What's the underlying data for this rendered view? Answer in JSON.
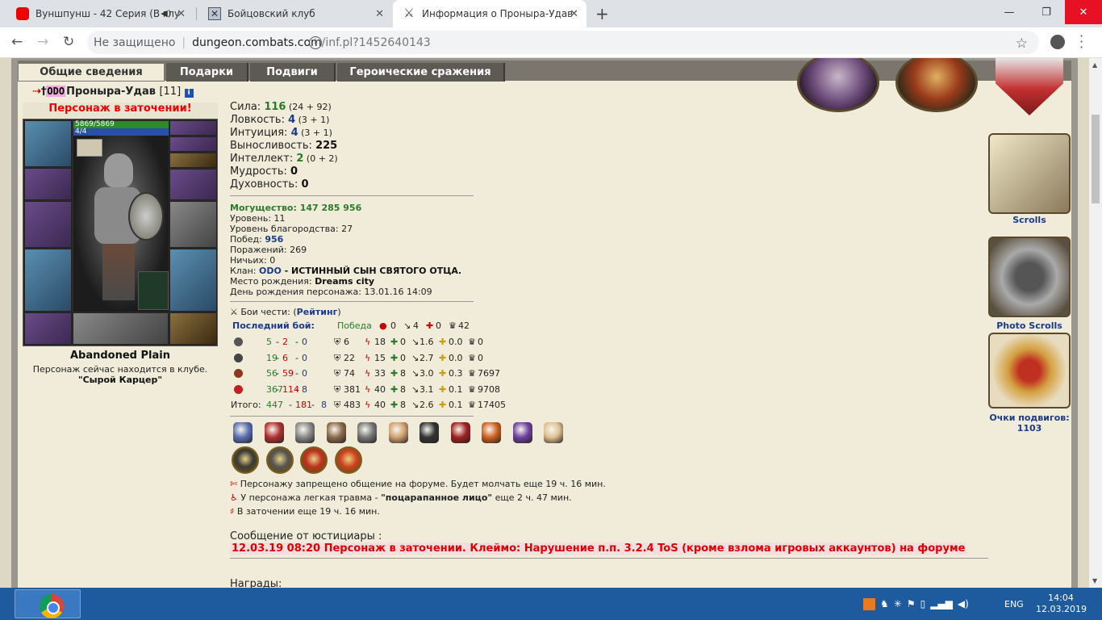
{
  "browser": {
    "tabs": [
      {
        "title": "Вуншпунш - 42 Серия (В глу"
      },
      {
        "title": "Бойцовский клуб"
      },
      {
        "title": "Информация о Проныра-Удав"
      }
    ],
    "new_tab": "+",
    "security": "Не защищено",
    "url_host": "dungeon.combats.com",
    "url_path": "/inf.pl?1452640143",
    "window_controls": {
      "minimize": "—",
      "restore": "❐",
      "close": "✕"
    }
  },
  "page_tabs": [
    "Общие сведения",
    "Подарки",
    "Подвиги",
    "Героические сражения"
  ],
  "character": {
    "clan_tag": "ODO",
    "name": "Проныра-Удав",
    "level": "[11]",
    "jail_notice": "Персонаж в заточении!",
    "hp": "5869/5869",
    "mp": "4/4",
    "location": "Abandoned Plain",
    "in_club_text": "Персонаж сейчас находится в клубе.",
    "club_room": "\"Сырой Карцер\""
  },
  "stats": [
    {
      "label": "Сила: ",
      "value": "116",
      "extra": " (24 + 92)",
      "color": "g"
    },
    {
      "label": "Ловкость: ",
      "value": "4",
      "extra": " (3 + 1)",
      "color": "bl"
    },
    {
      "label": "Интуиция: ",
      "value": "4",
      "extra": " (3 + 1)",
      "color": "bl"
    },
    {
      "label": "Выносливость: ",
      "value": "225",
      "extra": "",
      "color": ""
    },
    {
      "label": "Интеллект: ",
      "value": "2",
      "extra": " (0 + 2)",
      "color": "g"
    },
    {
      "label": "Мудрость: ",
      "value": "0",
      "extra": "",
      "color": ""
    },
    {
      "label": "Духовность: ",
      "value": "0",
      "extra": "",
      "color": ""
    }
  ],
  "info": {
    "power_label": "Могущество: ",
    "power_value": "147 285 956",
    "level_label": "Уровень: ",
    "level_value": "11",
    "nobility_label": "Уровень благородства: ",
    "nobility_value": "27",
    "wins_label": "Побед: ",
    "wins_value": "956",
    "losses_label": "Поражений: ",
    "losses_value": "269",
    "draws_label": "Ничьих: ",
    "draws_value": "0",
    "clan_label": "Клан: ",
    "clan_value": "ODO",
    "clan_motto": " - ИСТИННЫЙ СЫН СВЯТОГО ОТЦА.",
    "birthplace_label": "Место рождения: ",
    "birthplace_value": "Dreams city",
    "birthday_label": "День рождения персонажа: ",
    "birthday_value": "13.01.16 14:09"
  },
  "honor": {
    "label": "Бои чести: (",
    "link": "Рейтинг",
    "close": ")"
  },
  "last_battle": {
    "label": "Последний бой:",
    "result": "Победа",
    "v1": "0",
    "v2": "4",
    "v3": "0",
    "v4": "42"
  },
  "battle_rows": [
    {
      "w": "5",
      "l": "2",
      "d": "0",
      "c1": "6",
      "c2": "18",
      "c3": "0",
      "c4": "1.6",
      "c5": "0.0",
      "c6": "0"
    },
    {
      "w": "19",
      "l": "6",
      "d": "0",
      "c1": "22",
      "c2": "15",
      "c3": "0",
      "c4": "2.7",
      "c5": "0.0",
      "c6": "0"
    },
    {
      "w": "56",
      "l": "59",
      "d": "0",
      "c1": "74",
      "c2": "33",
      "c3": "8",
      "c4": "3.0",
      "c5": "0.3",
      "c6": "7697"
    },
    {
      "w": "367",
      "l": "114",
      "d": "8",
      "c1": "381",
      "c2": "40",
      "c3": "8",
      "c4": "3.1",
      "c5": "0.1",
      "c6": "9708"
    }
  ],
  "battle_total": {
    "label": "Итого:",
    "w": "447",
    "l": "181",
    "d": "8",
    "c1": "483",
    "c2": "40",
    "c3": "8",
    "c4": "2.6",
    "c5": "0.1",
    "c6": "17405"
  },
  "notes": [
    "Персонажу запрещено общение на форуме. Будет молчать еще 19 ч. 16 мин.",
    "У персонажа легкая травма - ",
    "\"поцарапанное лицо\"",
    " еще 2 ч. 47 мин.",
    "В заточении еще 19 ч. 16 мин."
  ],
  "justice": {
    "title": "Сообщение от юстициары :",
    "message": "12.03.19 08:20 Персонаж в заточении. Клеймо: Нарушение п.п. 3.2.4 ToS (кроме взлома игровых аккаунтов) на форуме"
  },
  "awards_label": "Награды:",
  "sidebar": {
    "scrolls": "Scrolls",
    "photo_scrolls": "Photo Scrolls",
    "feat_points_label": "Очки подвигов:",
    "feat_points_value": "1103"
  },
  "taskbar": {
    "lang": "ENG",
    "time": "14:04",
    "date": "12.03.2019"
  },
  "colors": {
    "page_bg": "#f0ecd9",
    "frame": "#9a9690",
    "link_blue": "#1a3a8a",
    "green": "#2b7a2b",
    "red": "#d00",
    "taskbar": "#1e5a9e"
  }
}
